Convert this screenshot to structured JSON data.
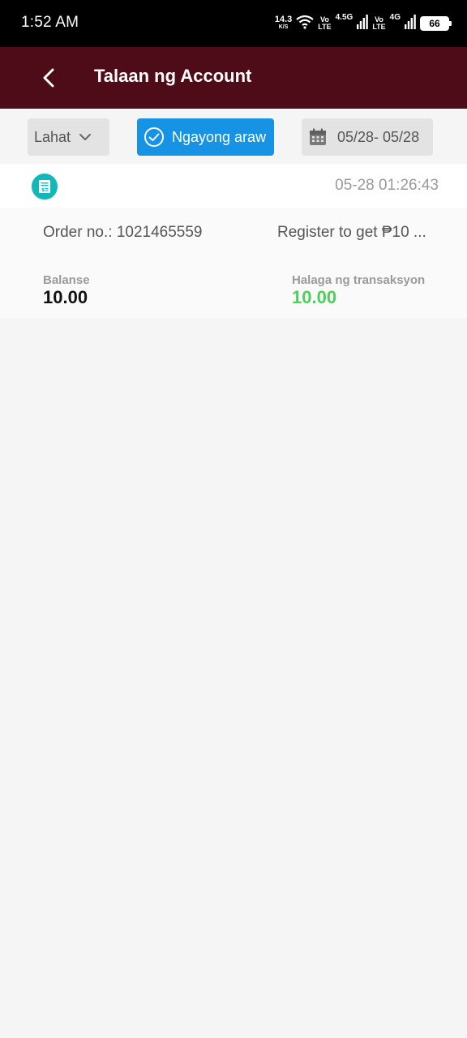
{
  "status_bar": {
    "time": "1:52 AM",
    "net_speed_value": "14.3",
    "net_speed_unit": "K/S",
    "sim1_volte_top": "Vo",
    "sim1_volte_bottom": "LTE",
    "sim1_network": "4.5G",
    "sim2_volte_top": "Vo",
    "sim2_volte_bottom": "LTE",
    "sim2_network": "4G",
    "battery": "66"
  },
  "header": {
    "title": "Talaan ng Account",
    "background": "#4e0b18"
  },
  "filters": {
    "all_label": "Lahat",
    "today_label": "Ngayong araw",
    "date_range": "05/28- 05/28",
    "active_color": "#1793e6"
  },
  "transactions": [
    {
      "time": "05-28 01:26:43",
      "order_no": "Order no.: 1021465559",
      "description": "Register to get ₱10 ...",
      "balance_label": "Balanse",
      "balance": "10.00",
      "amount_label": "Halaga ng transaksyon",
      "amount": "10.00",
      "amount_color": "#4cd05a",
      "icon": "receipt-icon"
    }
  ]
}
